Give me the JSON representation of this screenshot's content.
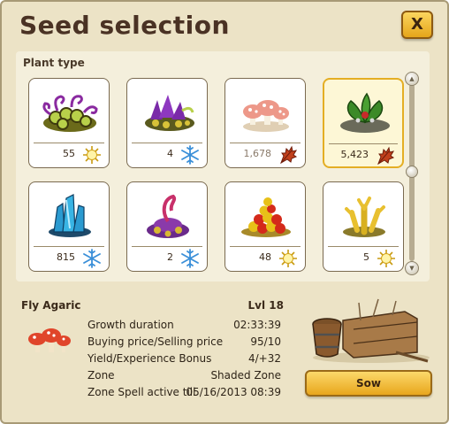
{
  "window": {
    "title": "Seed selection",
    "close_label": "X"
  },
  "plant_panel": {
    "label": "Plant type",
    "seeds": [
      {
        "count": "55",
        "season": "sun",
        "icon": "purple-spiral-plant-icon"
      },
      {
        "count": "4",
        "season": "snowflake",
        "icon": "purple-flower-cluster-icon"
      },
      {
        "count": "1,678",
        "season": "autumn-leaf",
        "icon": "fly-agaric-icon"
      },
      {
        "count": "5,423",
        "season": "autumn-leaf",
        "icon": "green-leaves-icon"
      },
      {
        "count": "815",
        "season": "snowflake",
        "icon": "blue-crystal-icon"
      },
      {
        "count": "2",
        "season": "snowflake",
        "icon": "purple-pod-plant-icon"
      },
      {
        "count": "48",
        "season": "sun",
        "icon": "red-yellow-berries-icon"
      },
      {
        "count": "5",
        "season": "sun",
        "icon": "yellow-coral-plant-icon"
      }
    ],
    "selected_index": 3
  },
  "details": {
    "name": "Fly Agaric",
    "level": "Lvl 18",
    "rows": [
      {
        "label": "Growth duration",
        "value": "02:33:39"
      },
      {
        "label": "Buying price/Selling price",
        "value": "95/10"
      },
      {
        "label": "Yield/Experience Bonus",
        "value": "4/+32"
      },
      {
        "label": "Zone",
        "value": "Shaded Zone"
      },
      {
        "label": "Zone Spell active till",
        "value": "05/16/2013 08:39"
      }
    ],
    "sow_label": "Sow"
  },
  "colors": {
    "background": "#ece3c6",
    "panel": "#f4efdc",
    "button_gold": "#e8a61d",
    "selected_border": "#e4ae24",
    "title_text": "#4a3224"
  }
}
